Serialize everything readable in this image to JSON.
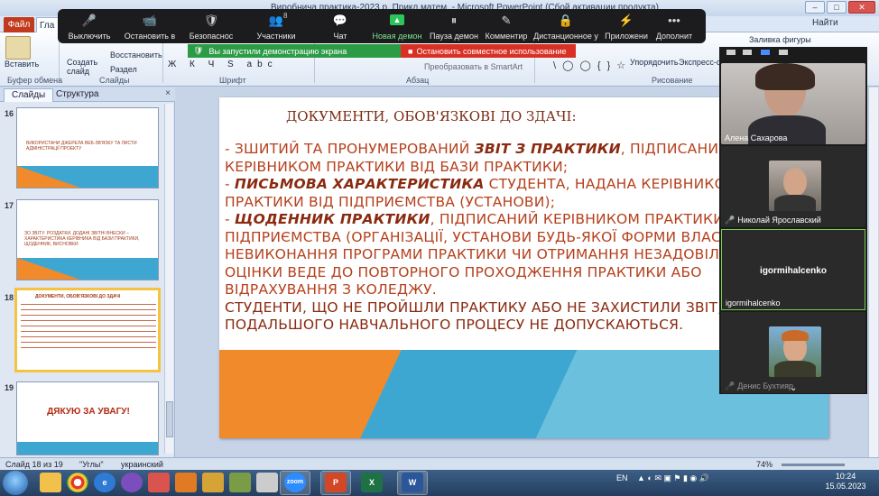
{
  "window": {
    "title": "Виробнича практика-2023 р. Прикл.матем. - Microsoft PowerPoint (Сбой активации продукта)",
    "buttons": [
      "–",
      "□",
      "✕"
    ]
  },
  "ribbon": {
    "file_tab": "Файл",
    "home_tab": "Гла",
    "right_tab": "Найти",
    "groups": {
      "clipboard": "Буфер обмена",
      "slides": "Слайды",
      "font": "Шрифт",
      "paragraph": "Абзац",
      "drawing": "Рисование"
    },
    "paste_label": "Вставить",
    "create_slide_label": "Создать слайд",
    "restore_label": "Восстановить",
    "section_label": "Раздел",
    "smartart_label": "Преобразовать в SmartArt",
    "arrange_label": "Упорядочить",
    "express_styles_label": "Экспресс-сти",
    "shape_fill_label": "Заливка фигуры",
    "format_buttons": "Ж К Ч S abc",
    "shapes_row": "\\ ◯ ◯ { } ☆"
  },
  "zoom_toolbar": {
    "items": [
      {
        "icon": "🎤",
        "label": "Выключить"
      },
      {
        "icon": "📹",
        "label": "Остановить в"
      },
      {
        "icon": "🛡",
        "label": "Безопаснос"
      },
      {
        "icon": "👥",
        "label": "Участники",
        "count": "8"
      },
      {
        "icon": "💬",
        "label": "Чат"
      },
      {
        "icon": "▲",
        "label": "Новая демон"
      },
      {
        "icon": "⏸",
        "label": "Пауза демон"
      },
      {
        "icon": "✎",
        "label": "Комментир"
      },
      {
        "icon": "🔒",
        "label": "Дистанционное у"
      },
      {
        "icon": "⚡",
        "label": "Приложени"
      },
      {
        "icon": "•••",
        "label": "Дополнит"
      }
    ],
    "share_notice": "Вы запустили демонстрацию экрана",
    "stop_share": "Остановить совместное использование"
  },
  "left_pane": {
    "tabs": [
      "Слайды",
      "Структура"
    ],
    "close": "×",
    "slides": [
      {
        "num": "16",
        "text": "ВИКОРИСТАНИ ДЖЕРЕЛА ВЕБ-ЗВ'ЯЗКУ ТА ЛИСТИ АДМІНІСТРАЦІЇ ПРОЕКТУ"
      },
      {
        "num": "17",
        "text": "ЗО ЗВІТУ: РОЗДАТКИ. ДОДАНІ ЗВІТНІ ВНЕСКИ – ХАРАКТЕРИСТИКА КЕРІВНИКА ВІД БАЗИ ПРАКТИКИ, ЩОДЕННИК, ВИСНОВКИ"
      },
      {
        "num": "18",
        "text": "ДОКУМЕНТИ, ОБОВ'ЯЗКОВІ ДО ЗДАЧІ"
      },
      {
        "num": "19",
        "text": "ДЯКУЮ ЗА УВАГУ!"
      }
    ]
  },
  "slide": {
    "title": "ДОКУМЕНТИ, ОБОВ'ЯЗКОВІ ДО ЗДАЧІ:",
    "lines": [
      {
        "pre": "- ЗШИТИЙ ТА ПРОНУМЕРОВАНИЙ ",
        "bi": "ЗВІТ З ПРАКТИКИ",
        "post": ", ПІДПИСАНИЙ"
      },
      {
        "pre": "КЕРІВНИКОМ ПРАКТИКИ ВІД БАЗИ ПРАКТИКИ;",
        "bi": "",
        "post": ""
      },
      {
        "pre": "- ",
        "bi": "ПИСЬМОВА ХАРАКТЕРИСТИКА",
        "post": " СТУДЕНТА, НАДАНА КЕРІВНИКОМ"
      },
      {
        "pre": "ПРАКТИКИ ВІД ПІДПРИЄМСТВА (УСТАНОВИ);",
        "bi": "",
        "post": ""
      },
      {
        "pre": "- ",
        "bi": "ЩОДЕННИК ПРАКТИКИ",
        "post": ", ПІДПИСАНИЙ КЕРІВНИКОМ ПРАКТИКИ"
      },
      {
        "pre": "ПІДПРИЄМСТВА (ОРГАНІЗАЦІЇ, УСТАНОВИ БУДЬ-ЯКОЇ ФОРМИ ВЛАСНОСТІ)",
        "bi": "",
        "post": ""
      },
      {
        "pre": "НЕВИКОНАННЯ ПРОГРАМИ ПРАКТИКИ ЧИ ОТРИМАННЯ НЕЗАДОВІЛЬНОЇ",
        "bi": "",
        "post": ""
      },
      {
        "pre": "ОЦІНКИ ВЕДЕ ДО ПОВТОРНОГО ПРОХОДЖЕННЯ ПРАКТИКИ АБО",
        "bi": "",
        "post": ""
      },
      {
        "pre": "ВІДРАХУВАННЯ З КОЛЕДЖУ.",
        "bi": "",
        "post": ""
      },
      {
        "pre": "СТУДЕНТИ, ЩО НЕ ПРОЙШЛИ ПРАКТИКУ АБО НЕ ЗАХИСТИЛИ ЗВІТ, ДО",
        "bi": "",
        "post": ""
      },
      {
        "pre": "ПОДАЛЬШОГО НАВЧАЛЬНОГО ПРОЦЕСУ НЕ ДОПУСКАЮТЬСЯ.",
        "bi": "",
        "post": ""
      }
    ]
  },
  "participants": [
    {
      "name": "Алена Сахарова",
      "muted": false
    },
    {
      "name": "Николай Ярославский",
      "muted": true
    },
    {
      "name": "igormihalcenko",
      "muted": false,
      "active": true
    },
    {
      "name": "Денис Бухтияр",
      "muted": true
    }
  ],
  "statusbar": {
    "slide_of": "Слайд 18 из 19",
    "theme": "\"Углы\"",
    "language": "украинский",
    "zoom": "74%"
  },
  "taskbar": {
    "lang": "EN",
    "time": "10:24",
    "date": "15.05.2023",
    "zoom_app": "zoom"
  },
  "colors": {
    "slide_text": "#b5401c",
    "accent_orange": "#f08a2a",
    "accent_blue": "#3ea7d1",
    "share_green": "#2c9b45",
    "share_red": "#d93025"
  }
}
